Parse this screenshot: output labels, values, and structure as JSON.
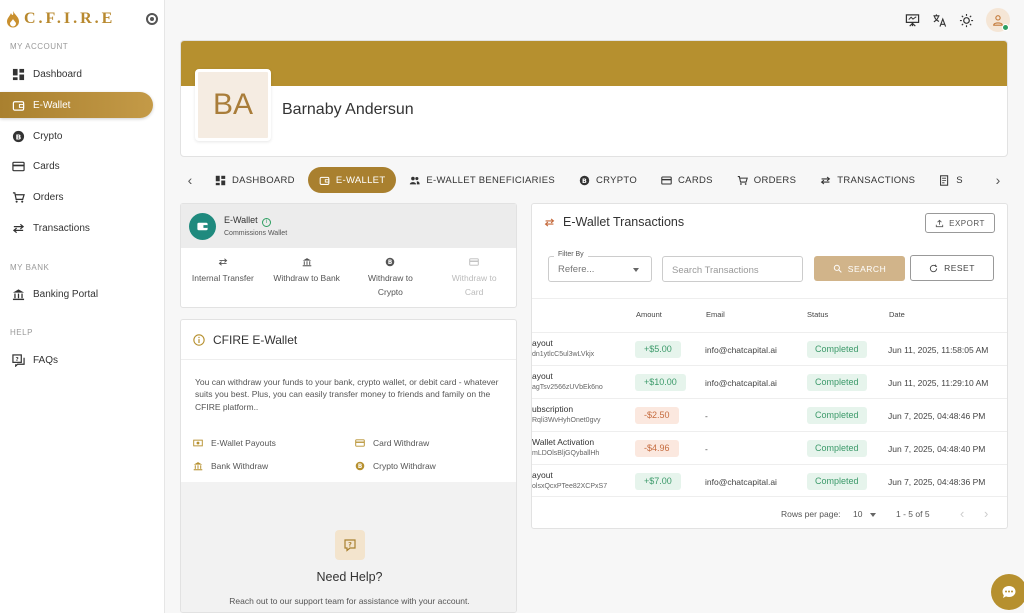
{
  "brand": {
    "name": "C.F.I.R.E"
  },
  "sidebar": {
    "sections": [
      "MY ACCOUNT",
      "MY BANK",
      "HELP"
    ],
    "items": [
      {
        "label": "Dashboard"
      },
      {
        "label": "E-Wallet"
      },
      {
        "label": "Crypto"
      },
      {
        "label": "Cards"
      },
      {
        "label": "Orders"
      },
      {
        "label": "Transactions"
      },
      {
        "label": "Banking Portal"
      },
      {
        "label": "FAQs"
      }
    ]
  },
  "topbar": {
    "icons": [
      "presentation-icon",
      "translate-icon",
      "theme-icon",
      "user-avatar"
    ]
  },
  "profile": {
    "initials": "BA",
    "name": "Barnaby Andersun"
  },
  "tabs": [
    "DASHBOARD",
    "E-WALLET",
    "E-WALLET BENEFICIARIES",
    "CRYPTO",
    "CARDS",
    "ORDERS",
    "TRANSACTIONS",
    "S"
  ],
  "wallet": {
    "title": "E-Wallet",
    "subtitle": "Commissions Wallet",
    "actions": [
      {
        "label": "Internal Transfer"
      },
      {
        "label": "Withdraw to Bank"
      },
      {
        "label": "Withdraw to Crypto"
      },
      {
        "label": "Withdraw to Card"
      }
    ]
  },
  "info": {
    "title": "CFIRE E-Wallet",
    "description": "You can withdraw your funds to your bank, crypto wallet, or debit card - whatever suits you best. Plus, you can easily transfer money to friends and family on the CFIRE platform..",
    "features": [
      "E-Wallet Payouts",
      "Card Withdraw",
      "Bank Withdraw",
      "Crypto Withdraw"
    ],
    "help_title": "Need Help?",
    "help_text": "Reach out to our support team for assistance with your account."
  },
  "transactions": {
    "title": "E-Wallet Transactions",
    "export_label": "EXPORT",
    "filter_label": "Filter By",
    "filter_value": "Refere...",
    "search_placeholder": "Search Transactions",
    "search_label": "SEARCH",
    "reset_label": "RESET",
    "columns": [
      "Amount",
      "Email",
      "Status",
      "Date"
    ],
    "rows": [
      {
        "type": "ayout",
        "ref": "dn1ytlcC5ul3wLVkjx",
        "amount": "+$5.00",
        "email": "info@chatcapital.ai",
        "status": "Completed",
        "date": "Jun 11, 2025, 11:58:05 AM"
      },
      {
        "type": "ayout",
        "ref": "agTsv2566zUVbEk6no",
        "amount": "+$10.00",
        "email": "info@chatcapital.ai",
        "status": "Completed",
        "date": "Jun 11, 2025, 11:29:10 AM"
      },
      {
        "type": "ubscription",
        "ref": "Rqli3WvHyhOnet0gvy",
        "amount": "-$2.50",
        "email": "-",
        "status": "Completed",
        "date": "Jun 7, 2025, 04:48:46 PM"
      },
      {
        "type": "Wallet Activation",
        "ref": "mLDOlsBljGQyballHh",
        "amount": "-$4.96",
        "email": "-",
        "status": "Completed",
        "date": "Jun 7, 2025, 04:48:40 PM"
      },
      {
        "type": "ayout",
        "ref": "olsxQcxPTee82XCPxS7",
        "amount": "+$7.00",
        "email": "info@chatcapital.ai",
        "status": "Completed",
        "date": "Jun 7, 2025, 04:48:36 PM"
      }
    ],
    "rows_per_page_label": "Rows per page:",
    "rows_per_page": "10",
    "range": "1 - 5 of 5"
  },
  "colors": {
    "accent": "#a9802f",
    "banner": "#b6902f",
    "positive": "#3c9a6a",
    "negative": "#c56b3e"
  }
}
